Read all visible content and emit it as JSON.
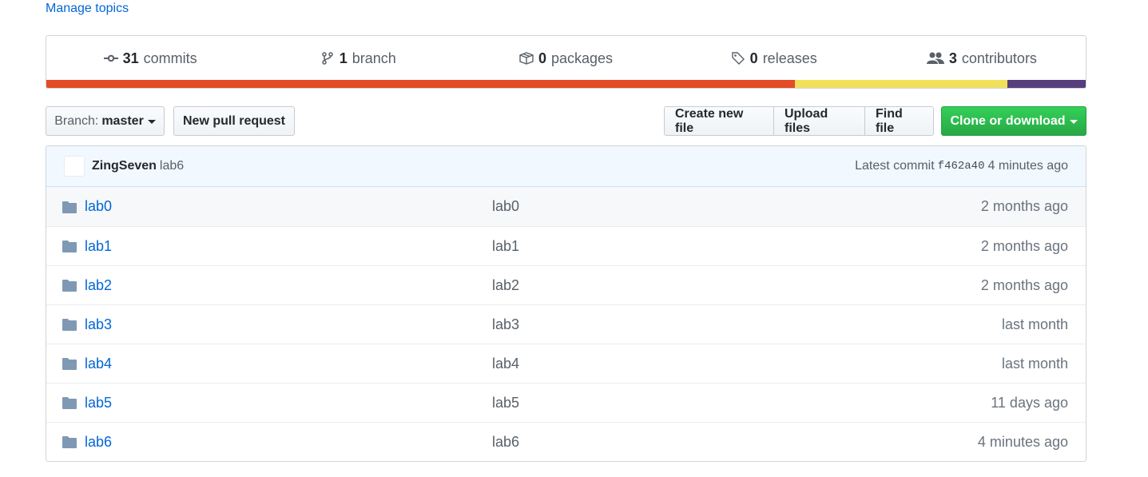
{
  "manage_topics": "Manage topics",
  "summary": {
    "commits_count": "31",
    "commits_label": "commits",
    "branch_count": "1",
    "branch_label": "branch",
    "packages_count": "0",
    "packages_label": "packages",
    "releases_count": "0",
    "releases_label": "releases",
    "contributors_count": "3",
    "contributors_label": "contributors"
  },
  "languages": [
    {
      "color": "#e34c26",
      "fraction": 0.72
    },
    {
      "color": "#f1e05a",
      "fraction": 0.205
    },
    {
      "color": "#563d7c",
      "fraction": 0.075
    }
  ],
  "toolbar": {
    "branch_prefix": "Branch:",
    "branch_name": "master",
    "new_pull_request": "New pull request",
    "create_new_file": "Create new file",
    "upload_files": "Upload files",
    "find_file": "Find file",
    "clone_or_download": "Clone or download"
  },
  "commit": {
    "author": "ZingSeven",
    "message": "lab6",
    "latest_label": "Latest commit",
    "sha": "f462a40",
    "age": "4 minutes ago"
  },
  "files": [
    {
      "name": "lab0",
      "message": "lab0",
      "age": "2 months ago"
    },
    {
      "name": "lab1",
      "message": "lab1",
      "age": "2 months ago"
    },
    {
      "name": "lab2",
      "message": "lab2",
      "age": "2 months ago"
    },
    {
      "name": "lab3",
      "message": "lab3",
      "age": "last month"
    },
    {
      "name": "lab4",
      "message": "lab4",
      "age": "last month"
    },
    {
      "name": "lab5",
      "message": "lab5",
      "age": "11 days ago"
    },
    {
      "name": "lab6",
      "message": "lab6",
      "age": "4 minutes ago"
    }
  ],
  "icons": {
    "commits": "commit-icon",
    "branch": "branch-icon",
    "packages": "package-icon",
    "releases": "tag-icon",
    "contributors": "people-icon",
    "folder": "folder-icon"
  }
}
